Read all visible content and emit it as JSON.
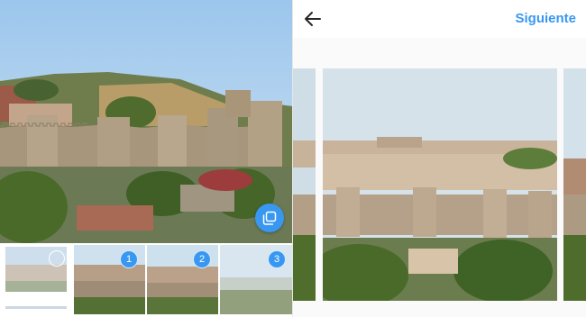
{
  "header": {
    "back_icon": "arrow-left-icon",
    "next_label": "Siguiente"
  },
  "gallery": {
    "multi_select_icon": "multiple-select-icon",
    "thumbnails": [
      {
        "name": "thumb-0",
        "badge": ""
      },
      {
        "name": "thumb-1",
        "badge": "1"
      },
      {
        "name": "thumb-2",
        "badge": "2"
      },
      {
        "name": "thumb-3",
        "badge": "3"
      }
    ]
  },
  "colors": {
    "accent": "#3897f0",
    "sky": "#bcd7ee",
    "wall": "#a8957a"
  }
}
